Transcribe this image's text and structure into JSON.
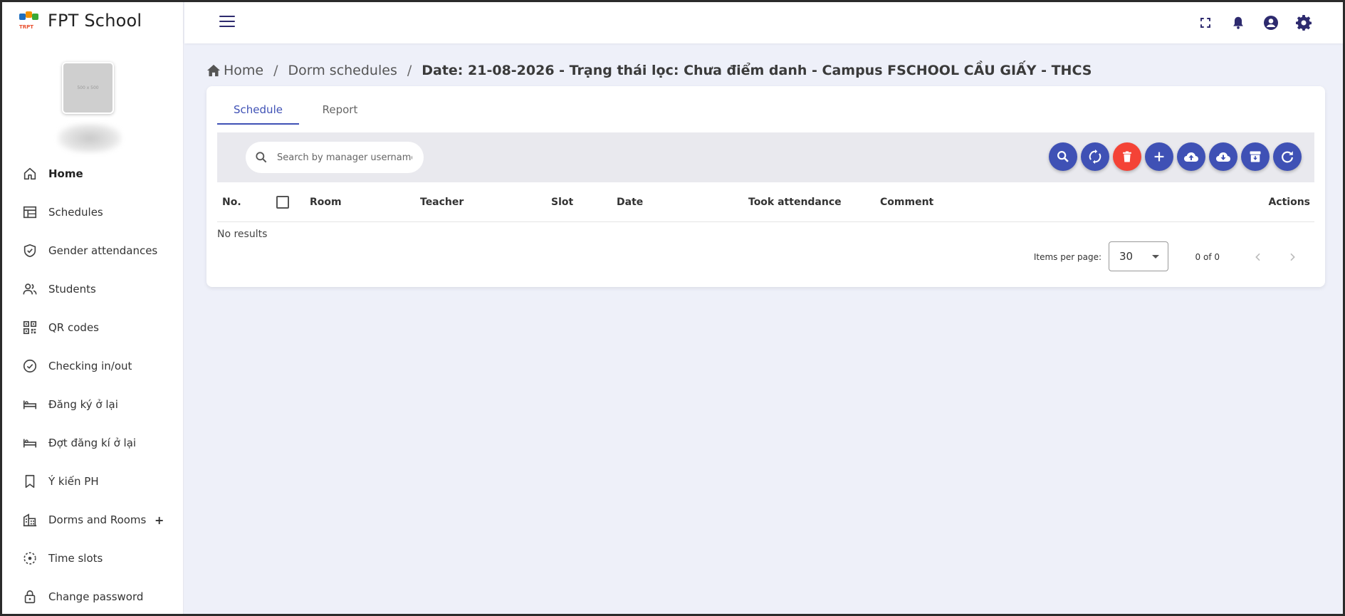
{
  "brand": {
    "name": "FPT School",
    "logo_text": "TRPT",
    "logo_colors": [
      "#1f6fbf",
      "#f39200",
      "#3aa935",
      "#e8502f"
    ]
  },
  "avatar": {
    "placeholder_text": "500 x 500"
  },
  "sidebar": {
    "items": [
      {
        "label": "Home",
        "icon": "home-icon",
        "active": true
      },
      {
        "label": "Schedules",
        "icon": "table-icon"
      },
      {
        "label": "Gender attendances",
        "icon": "shield-check-icon"
      },
      {
        "label": "Students",
        "icon": "people-icon"
      },
      {
        "label": "QR codes",
        "icon": "qr-code-icon"
      },
      {
        "label": "Checking in/out",
        "icon": "check-circle-icon"
      },
      {
        "label": "Đăng ký ở lại",
        "icon": "bed-icon"
      },
      {
        "label": "Đợt đăng kí ở lại",
        "icon": "bed-icon"
      },
      {
        "label": "Ý kiến PH",
        "icon": "bookmark-icon"
      },
      {
        "label": "Dorms and Rooms",
        "icon": "building-icon",
        "expand": "+"
      },
      {
        "label": "Time slots",
        "icon": "timer-dashed-icon"
      },
      {
        "label": "Change password",
        "icon": "lock-icon"
      }
    ]
  },
  "topbar": {
    "icons": [
      "fullscreen-icon",
      "bell-icon",
      "account-icon",
      "gear-icon"
    ]
  },
  "breadcrumb": {
    "home": "Home",
    "section": "Dorm schedules",
    "current": "Date: 21-08-2026 - Trạng thái lọc: Chưa điểm danh - Campus FSCHOOL CẦU GIẤY - THCS",
    "separator": "/"
  },
  "tabs": [
    {
      "label": "Schedule",
      "active": true
    },
    {
      "label": "Report",
      "active": false
    }
  ],
  "search": {
    "placeholder": "Search by manager username or"
  },
  "actions": [
    {
      "name": "search-button",
      "icon": "search-icon",
      "color": "#3f51b5"
    },
    {
      "name": "sync-button",
      "icon": "sync-icon",
      "color": "#3f51b5"
    },
    {
      "name": "delete-button",
      "icon": "trash-icon",
      "color": "#f44336"
    },
    {
      "name": "add-button",
      "icon": "plus-icon",
      "color": "#3f51b5"
    },
    {
      "name": "upload-button",
      "icon": "cloud-upload-icon",
      "color": "#3f51b5"
    },
    {
      "name": "download-button",
      "icon": "cloud-download-icon",
      "color": "#3f51b5"
    },
    {
      "name": "archive-button",
      "icon": "archive-icon",
      "color": "#3f51b5"
    },
    {
      "name": "refresh-button",
      "icon": "refresh-icon",
      "color": "#3f51b5"
    }
  ],
  "table": {
    "columns": [
      "No.",
      "Room",
      "Teacher",
      "Slot",
      "Date",
      "Took attendance",
      "Comment",
      "Actions"
    ],
    "empty_text": "No results"
  },
  "paginator": {
    "items_per_page_label": "Items per page:",
    "page_size": "30",
    "range_label": "0 of 0"
  },
  "colors": {
    "accent": "#3f51b5",
    "danger": "#f44336",
    "nav_icon": "#2d2a6e",
    "background": "#eef0f9"
  }
}
